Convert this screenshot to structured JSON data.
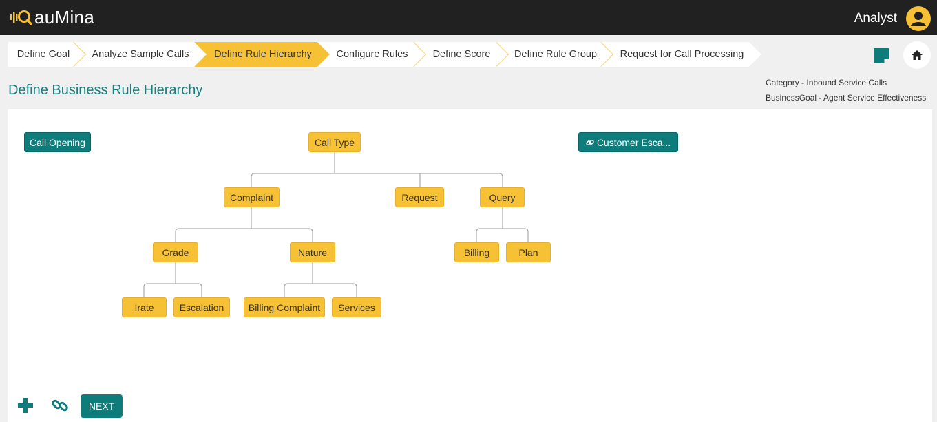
{
  "header": {
    "app_name": "auMina",
    "user_role": "Analyst",
    "brand_color": "#f7c136",
    "bar_color": "#212121"
  },
  "stepper": {
    "steps": [
      {
        "label": "Define Goal",
        "active": false
      },
      {
        "label": "Analyze Sample Calls",
        "active": false
      },
      {
        "label": "Define Rule Hierarchy",
        "active": true
      },
      {
        "label": "Configure Rules",
        "active": false
      },
      {
        "label": "Define Score",
        "active": false
      },
      {
        "label": "Define Rule Group",
        "active": false
      },
      {
        "label": "Request for Call Processing",
        "active": false
      }
    ],
    "active_color": "#f7c136"
  },
  "page": {
    "title": "Define Business Rule Hierarchy",
    "category": "Category - Inbound Service Calls",
    "business_goal": "BusinessGoal - Agent Service Effectiveness",
    "title_color": "#17807e"
  },
  "tree": {
    "standalone_left": "Call Opening",
    "standalone_right": "Customer Esca...",
    "root": "Call Type",
    "level1": [
      "Complaint",
      "Request",
      "Query"
    ],
    "complaint_children": [
      "Grade",
      "Nature"
    ],
    "query_children": [
      "Billing",
      "Plan"
    ],
    "grade_children": [
      "Irate",
      "Escalation"
    ],
    "nature_children": [
      "Billing Complaint",
      "Services"
    ]
  },
  "actions": {
    "next_label": "NEXT",
    "add_icon": "plus-icon",
    "link_icon": "link-icon"
  }
}
